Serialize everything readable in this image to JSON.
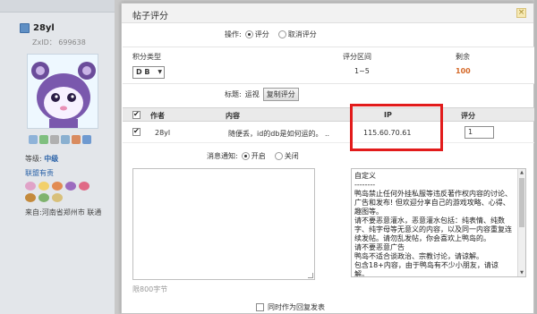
{
  "profile": {
    "username": "28yl",
    "zid": "ZxID： 699638",
    "level_label": "等级:",
    "level_value": "中级",
    "group": "联盟有责",
    "from": "来自:河南省郑州市 联通",
    "icon_names": [
      "message-icon",
      "add-friend-icon",
      "profile-icon",
      "email-icon",
      "block-icon",
      "avatar-user-icon"
    ],
    "medal_count": 8,
    "colors": {
      "link": "#2a62a8",
      "panel_bg": "#e3e6ea"
    }
  },
  "dialog": {
    "title": "帖子评分",
    "close_icon": "close-icon",
    "operation": {
      "label": "操作:",
      "options": [
        {
          "label": "评分",
          "checked": true
        },
        {
          "label": "取消评分",
          "checked": false
        }
      ]
    },
    "score_section": {
      "type_header": "积分类型",
      "range_header": "评分区间",
      "remain_header": "剩余",
      "type_value": "D B",
      "range_value": "1~5",
      "remain_value": "100",
      "remain_color": "#d56a2a"
    },
    "reason": {
      "label": "标题:",
      "value": "运视",
      "copy_button": "复制评分"
    },
    "table": {
      "headers": [
        "作者",
        "内容",
        "IP",
        "评分"
      ],
      "rows": [
        {
          "checked": true,
          "author": "28yl",
          "content": "随便丢，id的db是如何运的。 ..",
          "ip": "115.60.70.61",
          "score": "1"
        }
      ],
      "highlight_color": "#e21b1b"
    },
    "notify": {
      "label": "消息通知:",
      "options": [
        {
          "label": "开启",
          "checked": true
        },
        {
          "label": "关闭",
          "checked": false
        }
      ]
    },
    "message": {
      "counter": "限800字节"
    },
    "rules": {
      "title": "自定义",
      "text": "自定义\n--------\n鸭岛禁止任何外挂私服等违反著作权内容的讨论、广告和发布! 但欢迎分享自己的游戏攻略、心得、趣图等。\n请不要恶意灌水，恶意灌水包括：纯表情、纯数字、纯字母等无意义的内容，以及同一内容重复连续发帖。请勿乱发帖，你会喜欢上鸭岛的。\n请不要恶意广告\n鸭岛不适合谈政治、宗教讨论，请谅解。\n包含18+内容，由于鸭岛有不少小朋友，请谅解。"
    },
    "reply_option": {
      "label": "同时作为回复发表",
      "checked": false
    }
  }
}
